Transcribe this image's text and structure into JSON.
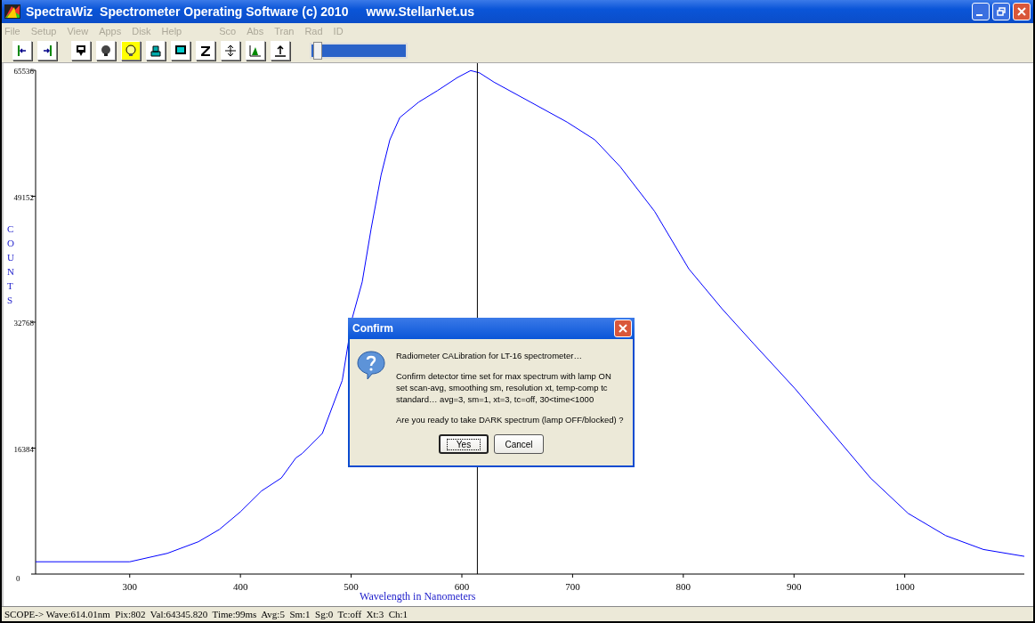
{
  "window": {
    "title": "SpectraWiz  Spectrometer Operating Software (c) 2010",
    "url": "www.StellarNet.us"
  },
  "menu": {
    "main": [
      {
        "label": "File",
        "disabled": true
      },
      {
        "label": "Setup",
        "disabled": true
      },
      {
        "label": "View",
        "disabled": true
      },
      {
        "label": "Apps",
        "disabled": true
      },
      {
        "label": "Disk",
        "disabled": true
      },
      {
        "label": "Help",
        "disabled": true
      }
    ],
    "modes": [
      {
        "label": "Sco",
        "disabled": true
      },
      {
        "label": "Abs",
        "disabled": true
      },
      {
        "label": "Tran",
        "disabled": true
      },
      {
        "label": "Rad",
        "disabled": true
      },
      {
        "label": "ID",
        "disabled": true
      }
    ]
  },
  "toolbar": {
    "slider": {
      "level": 0.02
    }
  },
  "chart": {
    "chart_data": {
      "type": "line",
      "xlabel": "Wavelength in Nanometers",
      "ylabel": "COUNTS",
      "x": [
        215,
        300,
        334,
        362,
        381,
        400,
        419,
        437,
        450,
        456,
        474,
        492,
        501,
        510,
        518,
        527,
        535,
        544,
        561,
        578,
        596,
        608,
        616,
        629,
        662,
        695,
        720,
        743,
        774,
        805,
        835,
        864,
        901,
        935,
        969,
        1003,
        1037,
        1071,
        1108
      ],
      "series": [
        {
          "color": "#0000ff",
          "values": [
            1600,
            1600,
            2700,
            4200,
            5800,
            8100,
            10800,
            12500,
            15100,
            15700,
            18300,
            25200,
            33300,
            38000,
            44900,
            51900,
            56500,
            59400,
            61400,
            62900,
            64600,
            65500,
            65200,
            64000,
            61400,
            58800,
            56500,
            53000,
            47200,
            39700,
            34500,
            29900,
            24100,
            18300,
            12500,
            7900,
            5000,
            3200,
            2300
          ]
        }
      ],
      "xlim": [
        215,
        1108
      ],
      "ylim": [
        0,
        65536
      ],
      "xticks": [
        300,
        400,
        500,
        600,
        700,
        800,
        900,
        1000
      ],
      "yticks": [
        0,
        16384,
        32768,
        49152,
        65536
      ],
      "ref_lines": [
        {
          "axis": "x",
          "value": 614.01
        }
      ]
    }
  },
  "dialog": {
    "title": "Confirm",
    "lines": [
      "Radiometer CALibration for LT-16 spectrometer…",
      "Confirm detector time set for max spectrum with lamp ON",
      "set scan-avg, smoothing sm, resolution xt, temp-comp tc",
      "standard… avg=3, sm=1, xt=3, tc=off, 30<time<1000",
      "Are you ready to take DARK spectrum (lamp OFF/blocked) ?"
    ],
    "buttons": [
      {
        "label": "Yes",
        "selected": true
      },
      {
        "label": "Cancel",
        "selected": false
      }
    ]
  },
  "status_bar": "SCOPE-> Wave:614.01nm  Pix:802  Val:64345.820  Time:99ms  Avg:5  Sm:1  Sg:0  Tc:off  Xt:3  Ch:1"
}
